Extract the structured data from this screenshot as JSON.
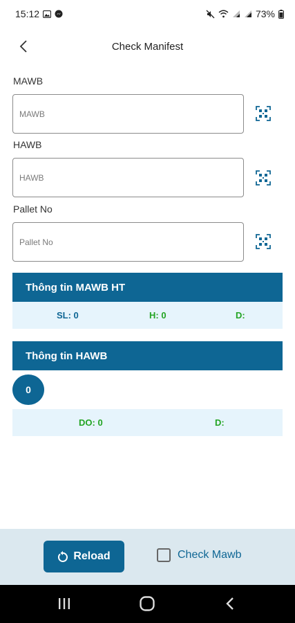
{
  "status_bar": {
    "time": "15:12",
    "battery": "73%",
    "icons": [
      "gallery-icon",
      "messenger-icon",
      "mute-icon",
      "wifi-icon",
      "signal-icon",
      "signal-icon",
      "battery-icon"
    ]
  },
  "app_bar": {
    "title": "Check Manifest",
    "back_icon": "chevron-left-icon"
  },
  "form": {
    "mawb": {
      "label": "MAWB",
      "placeholder": "MAWB",
      "value": ""
    },
    "hawb": {
      "label": "HAWB",
      "placeholder": "HAWB",
      "value": ""
    },
    "pallet": {
      "label": "Pallet No",
      "placeholder": "Pallet No",
      "value": ""
    },
    "scan_icon": "qr-scan-icon"
  },
  "mawb_info": {
    "title": "Thông tin MAWB HT",
    "sl": "SL: 0",
    "h": "H: 0",
    "d": "D:"
  },
  "hawb_info": {
    "title": "Thông tin HAWB",
    "count": "0",
    "do": "DO: 0",
    "d": "D:"
  },
  "bottom": {
    "reload_label": "Reload",
    "check_label": "Check Mawb",
    "check_checked": false
  },
  "colors": {
    "primary": "#0e6694",
    "light_blue": "#e6f4fc",
    "green": "#23a423",
    "bottom_bg": "#dbe8ef"
  }
}
